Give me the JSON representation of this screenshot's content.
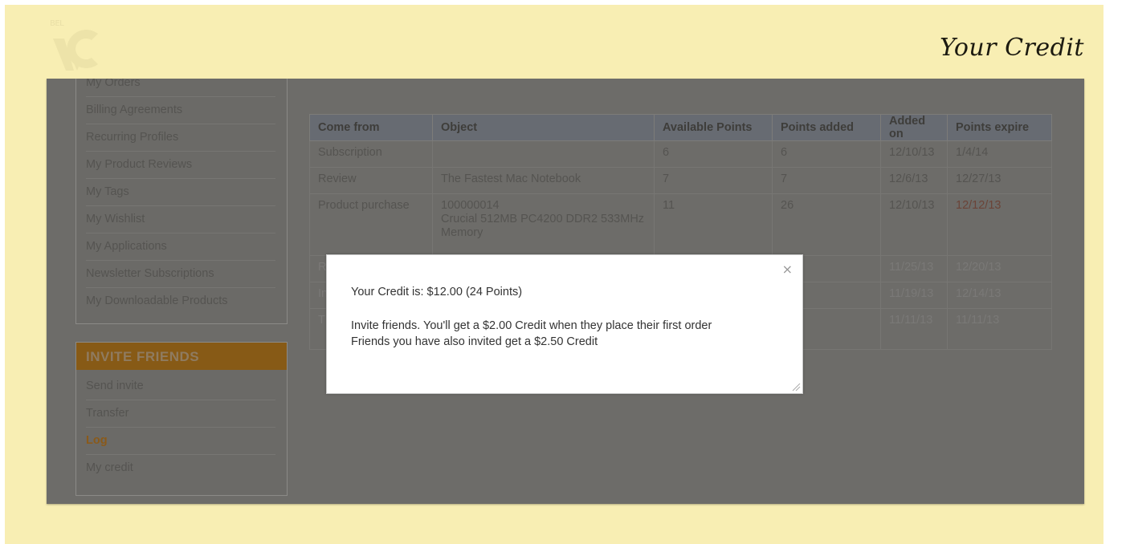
{
  "header": {
    "logo_text": "BEL",
    "title": "Your Credit"
  },
  "account_nav": {
    "items": [
      {
        "label": "My Orders"
      },
      {
        "label": "Billing Agreements"
      },
      {
        "label": "Recurring Profiles"
      },
      {
        "label": "My Product Reviews"
      },
      {
        "label": "My Tags"
      },
      {
        "label": "My Wishlist"
      },
      {
        "label": "My Applications"
      },
      {
        "label": "Newsletter Subscriptions"
      },
      {
        "label": "My Downloadable Products"
      }
    ]
  },
  "invite_nav": {
    "heading": "INVITE FRIENDS",
    "items": [
      {
        "label": "Send invite"
      },
      {
        "label": "Transfer"
      },
      {
        "label": "Log",
        "active": true
      },
      {
        "label": "My credit"
      }
    ]
  },
  "log_table": {
    "headers": [
      "Come from",
      "Object",
      "Available Points",
      "Points added",
      "Added on",
      "Points expire"
    ],
    "rows": [
      [
        "Subscription",
        "",
        "6",
        "6",
        "12/10/13",
        "1/4/14"
      ],
      [
        "Review",
        "The Fastest Mac Notebook",
        "7",
        "7",
        "12/6/13",
        "12/27/13"
      ],
      [
        "Product purchase",
        "100000014\nCrucial 512MB PC4200 DDR2 533MHz Memory",
        "11",
        "26",
        "12/10/13",
        "12/12/13"
      ],
      [
        "R",
        "",
        "",
        "",
        "11/25/13",
        "12/20/13"
      ],
      [
        "In",
        "",
        "",
        "",
        "11/19/13",
        "12/14/13"
      ],
      [
        "T",
        "",
        "",
        "",
        "11/11/13",
        "11/11/13"
      ]
    ]
  },
  "modal": {
    "close_label": "×",
    "credit_line": "Your Credit is: $12.00 (24 Points)",
    "invite_line": "Invite friends. You'll get a $2.00 Credit when they place their first order",
    "friends_line": "Friends you have also invited get a $2.50 Credit"
  },
  "colors": {
    "banner_bg": "#f8eeb3",
    "overlay": "#6d6c69",
    "invite_header": "#875a16",
    "expired_date": "#6b4438"
  }
}
